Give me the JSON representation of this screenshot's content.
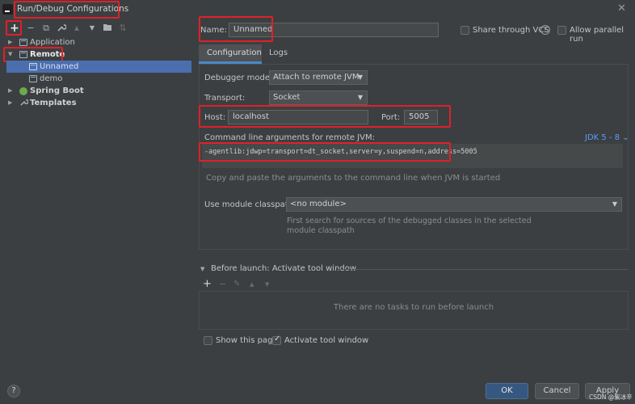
{
  "window": {
    "title": "Run/Debug Configurations"
  },
  "toolbar": {
    "add": "+",
    "remove": "−",
    "copy": "⧉",
    "edit": "🔧",
    "move_up": "▲",
    "move_down": "▼",
    "folder": "📁",
    "sort": "⇅"
  },
  "tree": {
    "application": "Application",
    "remote": "Remote",
    "unnamed": "Unnamed",
    "demo": "demo",
    "spring_boot": "Spring Boot",
    "templates": "Templates"
  },
  "form": {
    "name_label": "Name:",
    "name_value": "Unnamed",
    "share_vcs": "Share through VCS",
    "parallel": "Allow parallel run",
    "tab_configuration": "Configuration",
    "tab_logs": "Logs",
    "debugger_mode_label": "Debugger mode:",
    "debugger_mode_value": "Attach to remote JVM",
    "transport_label": "Transport:",
    "transport_value": "Socket",
    "host_label": "Host:",
    "host_value": "localhost",
    "port_label": "Port:",
    "port_value": "5005",
    "cmd_label": "Command line arguments for remote JVM:",
    "jdk_label": "JDK 5 - 8",
    "cmd_value": "-agentlib:jdwp=transport=dt_socket,server=y,suspend=n,address=5005",
    "cmd_hint": "Copy and paste the arguments to the command line when JVM is started",
    "module_label": "Use module classpath:",
    "module_value": "<no module>",
    "module_hint_1": "First search for sources of the debugged classes in the selected",
    "module_hint_2": "module classpath",
    "before_launch": "Before launch: Activate tool window",
    "no_tasks": "There are no tasks to run before launch",
    "show_page": "Show this page",
    "activate_tool": "Activate tool window"
  },
  "buttons": {
    "ok": "OK",
    "cancel": "Cancel",
    "apply": "Apply",
    "help": "?"
  },
  "watermark": "CSDN @紫冰辛"
}
